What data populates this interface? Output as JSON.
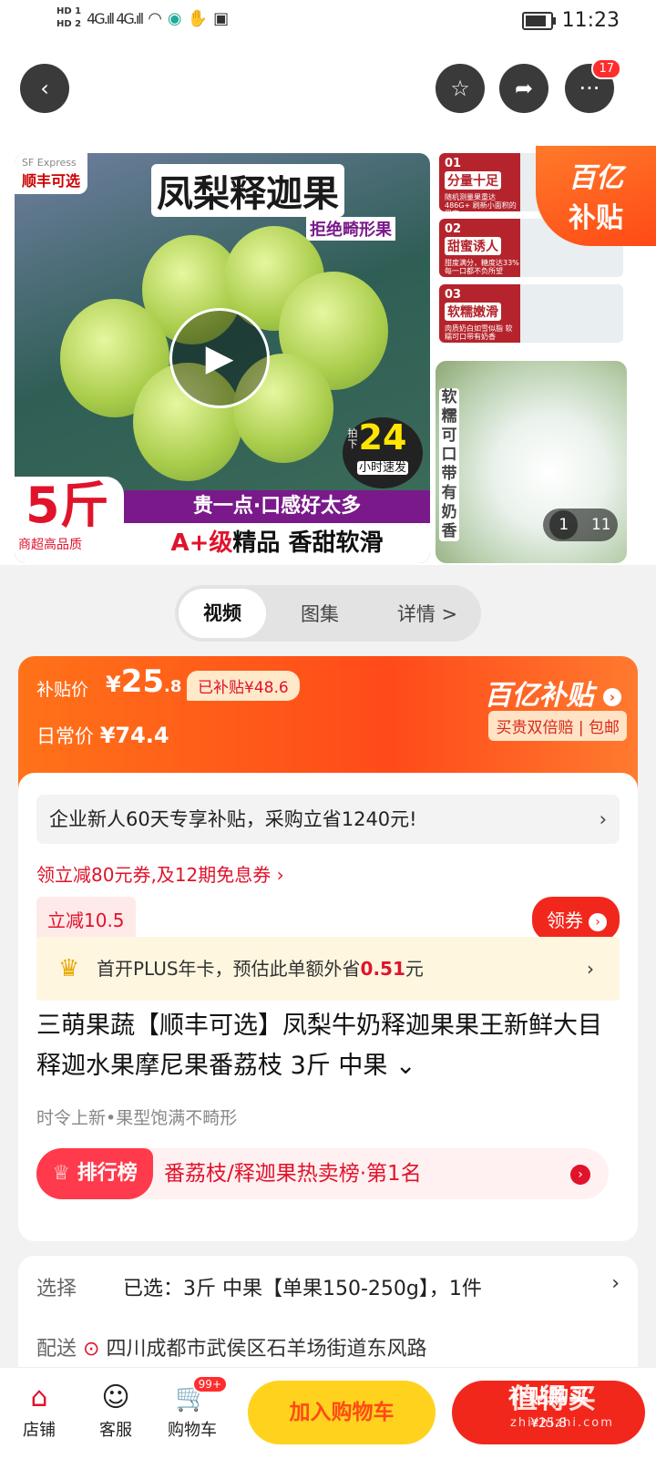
{
  "status": {
    "hd1": "HD 1",
    "hd2": "HD 2",
    "signal": "4G.ıll 4G.ıll",
    "time": "11:23"
  },
  "header": {
    "more_badge": "17"
  },
  "gallery": {
    "sf_express": "SF Express",
    "sf_brand": "顺丰可选",
    "main_title": "凤梨释迦果",
    "main_sub": "拒绝畸形果",
    "speed_pre": "拍下",
    "speed_num": "24",
    "speed_txt": "小时速发",
    "five": "5斤",
    "five_sub": "商超高品质",
    "slogan1": "贵一点·口感好太多",
    "slogan2_red": "A+级",
    "slogan2": "精品 香甜软滑",
    "features": [
      {
        "n": "01",
        "t": "分量十足",
        "d": "随机测量果重达486G+ 刷新小面积的果实"
      },
      {
        "n": "02",
        "t": "甜蜜诱人",
        "d": "甜度满分，糖度达33% 每一口都不负所望"
      },
      {
        "n": "03",
        "t": "软糯嫩滑",
        "d": "肉质奶白如雪似脂 软糯可口带有奶香"
      }
    ],
    "yi_badge_line1": "百亿",
    "yi_badge_line2": "补贴",
    "spoon_text": "软糯可口带有奶香",
    "counter_current": "1",
    "counter_total": "11"
  },
  "tabs": {
    "video": "视频",
    "gallery": "图集",
    "details": "详情 >"
  },
  "price": {
    "subsidy_label": "补贴价",
    "currency": "¥",
    "integer": "25",
    "decimal": ".8",
    "already_subsidy": "已补贴¥48.6",
    "daily_label": "日常价",
    "daily_price": "¥74.4",
    "brand": "百亿补贴",
    "guarantee": "买贵双倍赔 | 包邮"
  },
  "promo": {
    "enterprise": "企业新人60天专享补贴，采购立省1240元!",
    "coupon_link": "领立减80元券,及12期免息券 ›",
    "reduce_tag": "立减10.5",
    "coupon_button": "领券",
    "plus_text": "首开PLUS年卡，预估此单额外省",
    "plus_amount": "0.51",
    "plus_unit": "元"
  },
  "product": {
    "title": "三萌果蔬【顺丰可选】凤梨牛奶释迦果果王新鲜大目释迦水果摩尼果番荔枝 3斤 中果 ⌄",
    "subtitle": "时令上新•果型饱满不畸形",
    "rank_label": "排行榜",
    "rank_text": "番荔枝/释迦果热卖榜·第1名"
  },
  "selection": {
    "key": "选择",
    "value": "已选：3斤 中果【单果150-250g】，1件",
    "ship_key": "配送",
    "ship_value": "四川成都市武侯区石羊场街道东风路"
  },
  "bottom": {
    "shop": "店铺",
    "service": "客服",
    "cart": "购物车",
    "cart_badge": "99+",
    "add_cart": "加入购物车",
    "buy": "补贴购买",
    "buy_price": "¥25.8"
  },
  "watermark": {
    "text": "值得买",
    "url": "zhizhizhi.com"
  }
}
